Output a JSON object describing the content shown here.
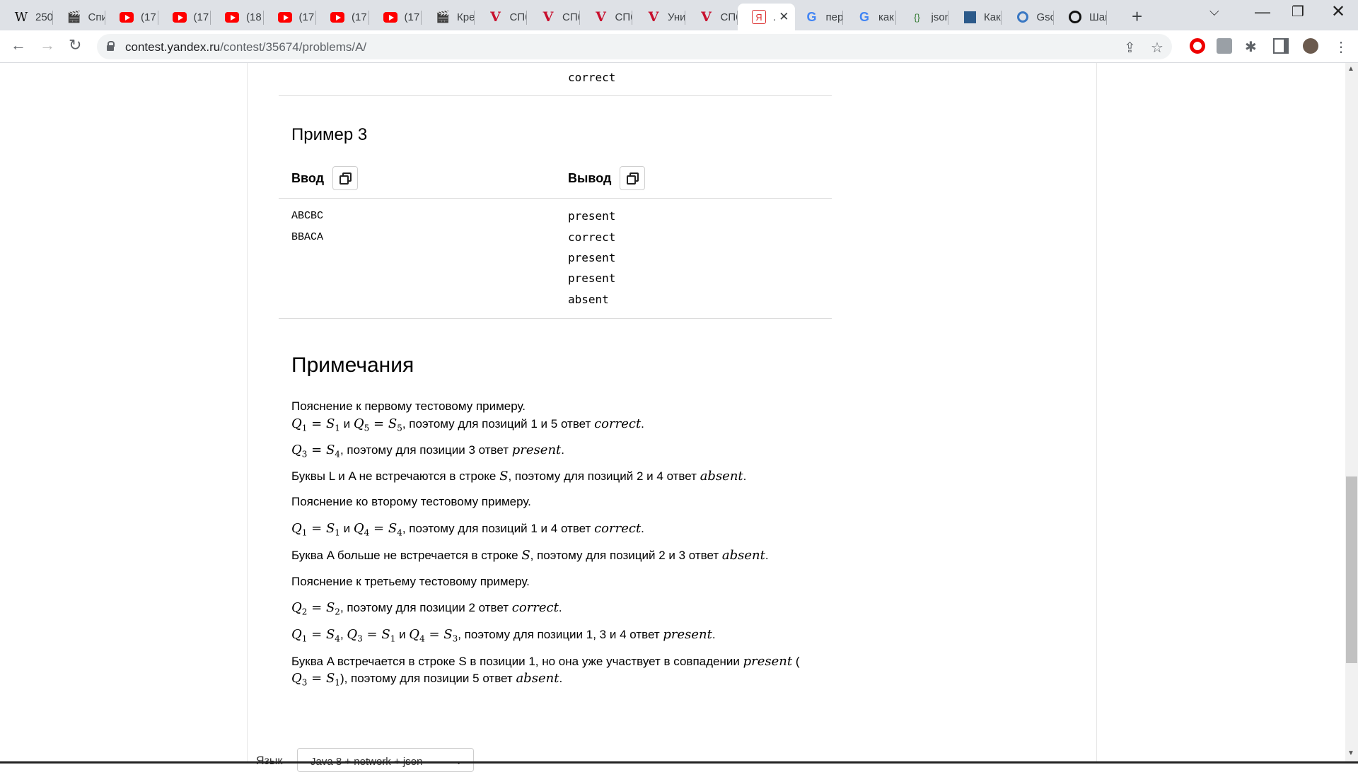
{
  "tabs": [
    {
      "icon": "wikipedia-icon",
      "title": "250"
    },
    {
      "icon": "clapperboard-icon",
      "title": "Спи"
    },
    {
      "icon": "youtube-icon",
      "title": "(17"
    },
    {
      "icon": "youtube-icon",
      "title": "(17"
    },
    {
      "icon": "youtube-icon",
      "title": "(18"
    },
    {
      "icon": "youtube-icon",
      "title": "(17"
    },
    {
      "icon": "youtube-icon",
      "title": "(17"
    },
    {
      "icon": "youtube-icon",
      "title": "(17"
    },
    {
      "icon": "clapperboard-icon",
      "title": "Кре"
    },
    {
      "icon": "v-logo-icon",
      "title": "СПб"
    },
    {
      "icon": "v-logo-icon",
      "title": "СПб"
    },
    {
      "icon": "v-logo-icon",
      "title": "СПб"
    },
    {
      "icon": "v-logo-icon",
      "title": "Уни"
    },
    {
      "icon": "v-logo-icon",
      "title": "СПб"
    },
    {
      "icon": "yandex-icon",
      "title": "."
    },
    {
      "icon": "google-icon",
      "title": "пер"
    },
    {
      "icon": "google-icon",
      "title": "как"
    },
    {
      "icon": "json-icon",
      "title": "json"
    },
    {
      "icon": "doc-icon",
      "title": "Как"
    },
    {
      "icon": "circle-icon",
      "title": "Gso"
    },
    {
      "icon": "disc-icon",
      "title": "Шаг"
    }
  ],
  "active_tab_index": 14,
  "address": {
    "host": "contest.yandex.ru",
    "path": "/contest/35674/problems/A/"
  },
  "prev_output_tail": "correct",
  "example": {
    "title": "Пример 3",
    "input_label": "Ввод",
    "output_label": "Вывод",
    "input_lines": [
      "ABCBC",
      "BBACA"
    ],
    "output_lines": [
      "present",
      "correct",
      "present",
      "present",
      "absent"
    ]
  },
  "notes": {
    "title": "Примечания",
    "p1": "Пояснение к первому тестовому примеру.",
    "p2_text": ", поэтому для позиций 1 и 5 ответ",
    "p2_and": "и",
    "p2_word": "correct",
    "p3_text": ", поэтому для позиции 3 ответ",
    "p3_word": "present",
    "p4_text_a": "Буквы L и A не встречаются в строке",
    "p4_text_b": ", поэтому для позиций 2 и 4 ответ",
    "p4_word": "absent",
    "p5": "Пояснение ко второму тестовому примеру.",
    "p6_text": ", поэтому для позиций 1 и 4 ответ",
    "p6_word": "correct",
    "p7_text_a": "Буква A больше не встречается в строке",
    "p7_text_b": ", поэтому для позиций 2 и 3 ответ",
    "p7_word": "absent",
    "p8": "Пояснение к третьему тестовому примеру.",
    "p9_text": ", поэтому для позиции 2 ответ",
    "p9_word": "correct",
    "p10_text": ", поэтому для позиции 1, 3 и 4 ответ",
    "p10_word": "present",
    "p11_text_a": "Буква A встречается в строке S в позиции 1, но она уже участвует в совпадении",
    "p11_word_a": "present",
    "p11_text_b": ", поэтому для позиции 5 ответ",
    "p11_word_b": "absent"
  },
  "language": {
    "label": "Язык",
    "selected": "Java 8 + network + json"
  }
}
